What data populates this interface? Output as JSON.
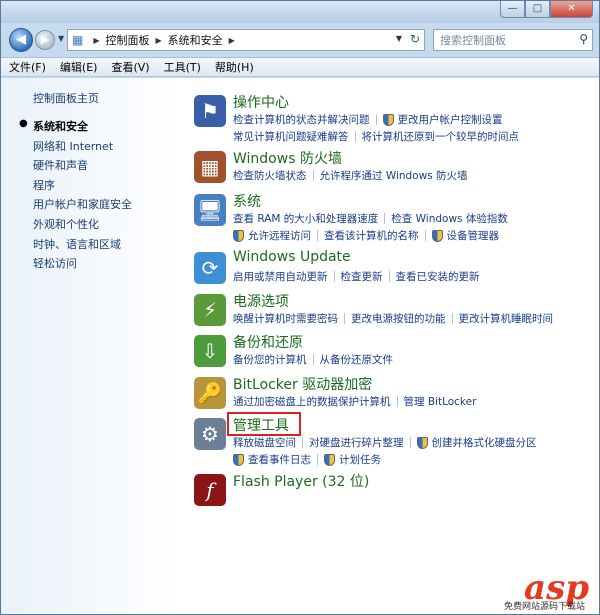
{
  "window": {
    "min_glyph": "—",
    "max_glyph": "□",
    "close_glyph": "✕"
  },
  "address_bar": {
    "crumbs": [
      "控制面板",
      "系统和安全"
    ]
  },
  "search": {
    "placeholder": "搜索控制面板"
  },
  "menu": [
    "文件(F)",
    "编辑(E)",
    "查看(V)",
    "工具(T)",
    "帮助(H)"
  ],
  "sidebar": {
    "home": "控制面板主页",
    "items": [
      "系统和安全",
      "网络和 Internet",
      "硬件和声音",
      "程序",
      "用户帐户和家庭安全",
      "外观和个性化",
      "时钟、语言和区域",
      "轻松访问"
    ]
  },
  "categories": [
    {
      "title": "操作中心",
      "icon": "flag-icon",
      "rows": [
        [
          "检查计算机的状态并解决问题",
          "更改用户帐户控制设置"
        ],
        [
          "常见计算机问题疑难解答",
          "将计算机还原到一个较早的时间点"
        ]
      ]
    },
    {
      "title": "Windows 防火墙",
      "icon": "firewall-icon",
      "rows": [
        [
          "检查防火墙状态",
          "允许程序通过 Windows 防火墙"
        ]
      ]
    },
    {
      "title": "系统",
      "icon": "computer-icon",
      "rows": [
        [
          "查看 RAM 的大小和处理器速度",
          "检查 Windows 体验指数"
        ],
        [
          "允许远程访问",
          "查看该计算机的名称",
          "设备管理器"
        ]
      ]
    },
    {
      "title": "Windows Update",
      "icon": "windows-update-icon",
      "rows": [
        [
          "启用或禁用自动更新",
          "检查更新",
          "查看已安装的更新"
        ]
      ]
    },
    {
      "title": "电源选项",
      "icon": "battery-icon",
      "rows": [
        [
          "唤醒计算机时需要密码",
          "更改电源按钮的功能",
          "更改计算机睡眠时间"
        ]
      ]
    },
    {
      "title": "备份和还原",
      "icon": "backup-icon",
      "rows": [
        [
          "备份您的计算机",
          "从备份还原文件"
        ]
      ]
    },
    {
      "title": "BitLocker 驱动器加密",
      "icon": "bitlocker-key-icon",
      "rows": [
        [
          "通过加密磁盘上的数据保护计算机",
          "管理 BitLocker"
        ]
      ]
    },
    {
      "title": "管理工具",
      "icon": "admin-tools-icon",
      "rows": [
        [
          "释放磁盘空间",
          "对硬盘进行碎片整理",
          "创建并格式化硬盘分区"
        ],
        [
          "查看事件日志",
          "计划任务"
        ]
      ]
    },
    {
      "title": "Flash Player (32 位)",
      "icon": "flash-icon",
      "rows": []
    }
  ],
  "watermark": {
    "logo": "asp",
    "sub": "免费网站源码下载站"
  },
  "colors": {
    "category_title": "#1d6b1d",
    "link": "#1a3d8f",
    "highlight": "#e02020"
  }
}
